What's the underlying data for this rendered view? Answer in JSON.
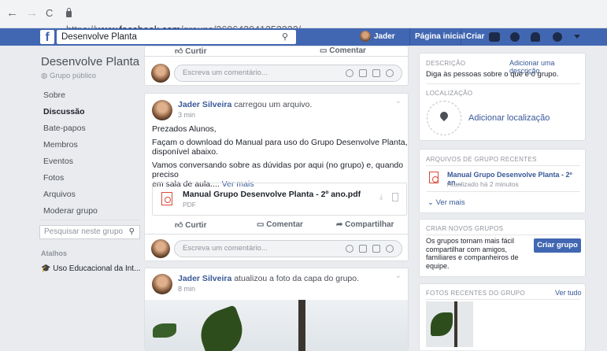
{
  "browser": {
    "url_prefix": "https://",
    "url_host": "www.facebook.com",
    "url_path": "/groups/360642041252222/",
    "back": "←",
    "forward": "→",
    "reload": "C"
  },
  "topbar": {
    "logo": "f",
    "search_value": "Desenvolve Planta",
    "user_name": "Jader",
    "home": "Página inicial",
    "create": "Criar"
  },
  "sidebar": {
    "group_name": "Desenvolve Planta",
    "privacy": "Grupo público",
    "items": [
      {
        "label": "Sobre",
        "active": false
      },
      {
        "label": "Discussão",
        "active": true
      },
      {
        "label": "Bate-papos",
        "active": false
      },
      {
        "label": "Membros",
        "active": false
      },
      {
        "label": "Eventos",
        "active": false
      },
      {
        "label": "Fotos",
        "active": false
      },
      {
        "label": "Arquivos",
        "active": false
      },
      {
        "label": "Moderar grupo",
        "active": false
      }
    ],
    "search_placeholder": "Pesquisar neste grupo",
    "shortcuts_label": "Atalhos",
    "shortcut_item": "Uso Educacional da Int..."
  },
  "feed": {
    "top_actions": {
      "like": "Curtir",
      "comment": "Comentar"
    },
    "comment_placeholder": "Escreva um comentário...",
    "post1": {
      "author": "Jader Silveira",
      "action": " carregou um arquivo.",
      "time": "3 min",
      "line1": "Prezados Alunos,",
      "line2": "Façam o download do Manual para uso do Grupo Desenvolve Planta,",
      "line3": "disponível abaixo.",
      "line4": "Vamos conversando sobre as dúvidas por aqui (no grupo) e, quando preciso",
      "line5": "em sala de aula....",
      "see_more": " Ver mais",
      "file_name": "Manual Grupo Desenvolve Planta - 2º ano.pdf",
      "file_type": "PDF",
      "like": "Curtir",
      "comment": "Comentar",
      "share": "Compartilhar"
    },
    "post2": {
      "author": "Jader Silveira",
      "action": " atualizou a foto da capa do grupo.",
      "time": "8 min"
    }
  },
  "right": {
    "desc_label": "DESCRIÇÃO",
    "desc_add": "Adicionar uma descrição",
    "desc_text": "Diga às pessoas sobre o que é o grupo.",
    "loc_label": "LOCALIZAÇÃO",
    "loc_add": "Adicionar localização",
    "files_label": "ARQUIVOS DE GRUPO RECENTES",
    "file_title": "Manual Grupo Desenvolve Planta - 2º an...",
    "file_updated": "Atualizado há 2 minutos",
    "see_more": "Ver mais",
    "create_label": "CRIAR NOVOS GRUPOS",
    "create_text1": "Os grupos tornam mais fácil",
    "create_text2": "compartilhar com amigos,",
    "create_text3": "familiares e companheiros de",
    "create_text4": "equipe.",
    "create_button": "Criar grupo",
    "photos_label": "FOTOS RECENTES DO GRUPO",
    "photos_all": "Ver tudo"
  },
  "colors": {
    "brand": "#4267b2",
    "link": "#385898",
    "background": "#e9ebee"
  }
}
